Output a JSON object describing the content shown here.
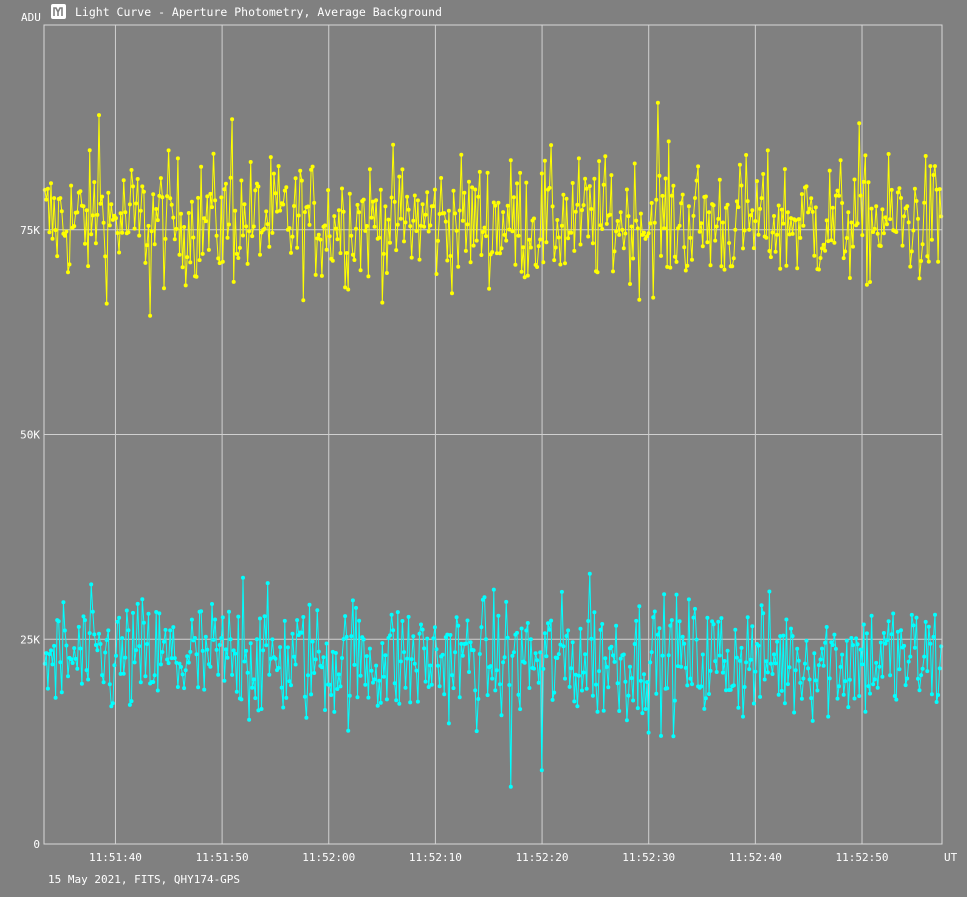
{
  "window": {
    "title": "Light Curve - Aperture Photometry, Average Background",
    "icon": "light-curve-app-icon",
    "footer": "15 May 2021, FITS, QHY174-GPS"
  },
  "chart_data": {
    "type": "line",
    "title": "Light Curve - Aperture Photometry, Average Background",
    "ylabel": "ADU",
    "xlabel": "UT",
    "ylim": [
      0,
      100000
    ],
    "xlim_seconds_after_11_51_00": [
      33.3,
      117.5
    ],
    "y_ticks": [
      {
        "value": 0,
        "label": "0"
      },
      {
        "value": 25000,
        "label": "25K"
      },
      {
        "value": 50000,
        "label": "50K"
      },
      {
        "value": 75000,
        "label": "75K"
      }
    ],
    "x_ticks": [
      {
        "value": 40,
        "label": "11:51:40"
      },
      {
        "value": 50,
        "label": "11:51:50"
      },
      {
        "value": 60,
        "label": "11:52:00"
      },
      {
        "value": 70,
        "label": "11:52:10"
      },
      {
        "value": 80,
        "label": "11:52:20"
      },
      {
        "value": 90,
        "label": "11:52:30"
      },
      {
        "value": 100,
        "label": "11:52:40"
      },
      {
        "value": 110,
        "label": "11:52:50"
      }
    ],
    "grid": true,
    "legend": "none",
    "series": [
      {
        "color": "#ffff00",
        "marker": "dot",
        "mean": 76000,
        "min": 64500,
        "max": 91000,
        "approx_samples": 580,
        "notable_points": [
          {
            "x": 38.4,
            "y": 89000
          },
          {
            "x": 50.9,
            "y": 88500
          },
          {
            "x": 90.8,
            "y": 90500
          },
          {
            "x": 109.8,
            "y": 88000
          },
          {
            "x": 43.2,
            "y": 64500
          }
        ]
      },
      {
        "color": "#00ffff",
        "marker": "dot",
        "mean": 22500,
        "min": 7000,
        "max": 33000,
        "approx_samples": 580,
        "notable_points": [
          {
            "x": 77.1,
            "y": 7000
          },
          {
            "x": 80.0,
            "y": 32700
          },
          {
            "x": 84.5,
            "y": 33000
          },
          {
            "x": 52.0,
            "y": 32500
          },
          {
            "x": 80.0,
            "y": 9000
          }
        ]
      }
    ]
  }
}
